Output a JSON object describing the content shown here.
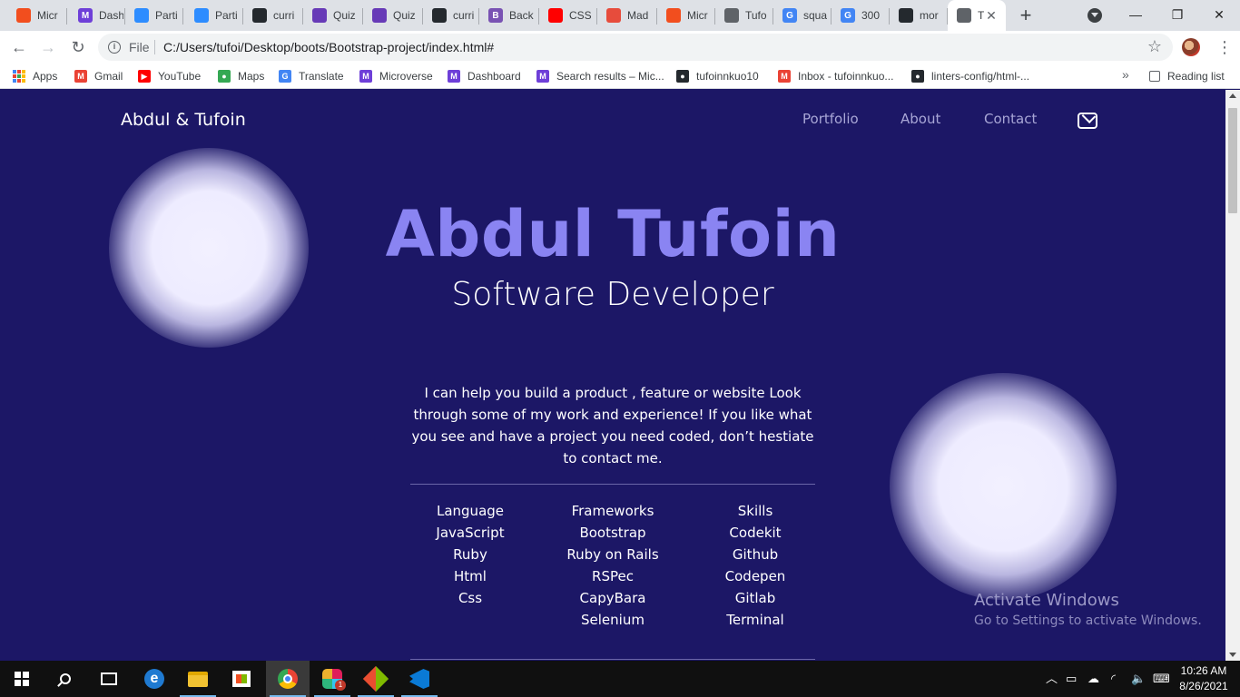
{
  "browser": {
    "tabs": [
      {
        "title": "Micr",
        "fav_color": "#f24e1e",
        "fav_text": ""
      },
      {
        "title": "Dash",
        "fav_color": "#6e3fd8",
        "fav_text": "M"
      },
      {
        "title": "Parti",
        "fav_color": "#2d8cff",
        "fav_text": ""
      },
      {
        "title": "Parti",
        "fav_color": "#2d8cff",
        "fav_text": ""
      },
      {
        "title": "curri",
        "fav_color": "#24292e",
        "fav_text": ""
      },
      {
        "title": "Quiz",
        "fav_color": "#673ab7",
        "fav_text": ""
      },
      {
        "title": "Quiz",
        "fav_color": "#673ab7",
        "fav_text": ""
      },
      {
        "title": "curri",
        "fav_color": "#24292e",
        "fav_text": ""
      },
      {
        "title": "Back",
        "fav_color": "#7952b3",
        "fav_text": "B"
      },
      {
        "title": "CSS",
        "fav_color": "#ff0000",
        "fav_text": ""
      },
      {
        "title": "Mad",
        "fav_color": "#e74c3c",
        "fav_text": ""
      },
      {
        "title": "Micr",
        "fav_color": "#f24e1e",
        "fav_text": ""
      },
      {
        "title": "Tufo",
        "fav_color": "#5f6368",
        "fav_text": ""
      },
      {
        "title": "squa",
        "fav_color": "#4285f4",
        "fav_text": "G"
      },
      {
        "title": "300",
        "fav_color": "#4285f4",
        "fav_text": "G"
      },
      {
        "title": "mor",
        "fav_color": "#24292e",
        "fav_text": ""
      },
      {
        "title": "T",
        "fav_color": "#5f6368",
        "fav_text": ""
      }
    ],
    "new_tab_label": "+",
    "window_buttons": {
      "minimize": "—",
      "maximize": "❐",
      "close": "✕"
    },
    "file_label": "File",
    "url": "C:/Users/tufoi/Desktop/boots/Bootstrap-project/index.html#",
    "bookmarks": [
      {
        "label": "Apps",
        "icon": "apps-grid"
      },
      {
        "label": "Gmail",
        "icon": "gmail-icon",
        "color": "#ea4335",
        "glyph": "M"
      },
      {
        "label": "YouTube",
        "icon": "youtube-icon",
        "color": "#ff0000",
        "glyph": "▶"
      },
      {
        "label": "Maps",
        "icon": "maps-icon",
        "color": "#34a853",
        "glyph": "●"
      },
      {
        "label": "Translate",
        "icon": "translate-icon",
        "color": "#4285f4",
        "glyph": "G"
      },
      {
        "label": "Microverse",
        "icon": "microverse-icon",
        "color": "#6e3fd8",
        "glyph": "M"
      },
      {
        "label": "Dashboard",
        "icon": "microverse-icon",
        "color": "#6e3fd8",
        "glyph": "M"
      },
      {
        "label": "Search results – Mic...",
        "icon": "microverse-icon",
        "color": "#6e3fd8",
        "glyph": "M"
      },
      {
        "label": "tufoinnkuo10",
        "icon": "github-icon",
        "color": "#24292e",
        "glyph": "●"
      },
      {
        "label": "Inbox - tufoinnkuo...",
        "icon": "gmail-icon",
        "color": "#ea4335",
        "glyph": "M"
      },
      {
        "label": "linters-config/html-...",
        "icon": "github-icon",
        "color": "#24292e",
        "glyph": "●"
      }
    ],
    "bookmarks_more": "»",
    "reading_list": "Reading list"
  },
  "page": {
    "brand": "Abdul & Tufoin",
    "nav": [
      "Portfolio",
      "About",
      "Contact"
    ],
    "hero_name": "Abdul Tufoin",
    "hero_role": "Software Developer",
    "intro": "I can help you build a product , feature or website Look through some of my work and experience! If you like what you see and have a project you need coded, don’t hestiate to contact me.",
    "columns": [
      {
        "heading": "Language",
        "items": [
          "JavaScript",
          "Ruby",
          "Html",
          "Css"
        ]
      },
      {
        "heading": "Frameworks",
        "items": [
          "Bootstrap",
          "Ruby on Rails",
          "RSPec",
          "CapyBara",
          "Selenium"
        ]
      },
      {
        "heading": "Skills",
        "items": [
          "Codekit",
          "Github",
          "Codepen",
          "Gitlab",
          "Terminal"
        ]
      }
    ],
    "colors": {
      "background": "#1c1766",
      "accent": "#8a84f2",
      "nav": "#a8a6d6"
    }
  },
  "watermark": {
    "line1": "Activate Windows",
    "line2": "Go to Settings to activate Windows."
  },
  "taskbar": {
    "time": "10:26 AM",
    "date": "8/26/2021",
    "slack_badge": "1"
  }
}
